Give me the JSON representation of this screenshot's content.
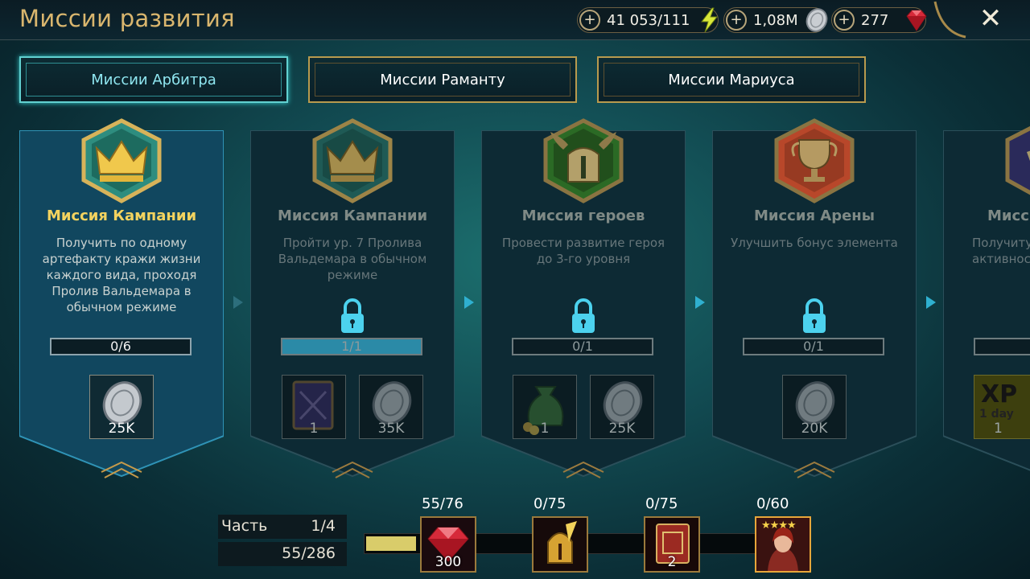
{
  "header": {
    "title": "Миссии развития",
    "resources": [
      {
        "name": "energy",
        "value": "41 053/111",
        "icon": "lightning-icon"
      },
      {
        "name": "silver",
        "value": "1,08M",
        "icon": "silver-coin-icon"
      },
      {
        "name": "gems",
        "value": "277",
        "icon": "ruby-icon"
      }
    ],
    "close_icon": "close-icon"
  },
  "tabs": [
    {
      "label": "Миссии Арбитра",
      "active": true
    },
    {
      "label": "Миссии Раманту",
      "active": false
    },
    {
      "label": "Миссии Мариуса",
      "active": false
    }
  ],
  "missions": [
    {
      "title": "Миссия Кампании",
      "description": "Получить по одному артефакту кражи жизни каждого вида, проходя Пролив Вальдемара в обычном режиме",
      "progress": "0/6",
      "progress_fraction": 0,
      "locked": false,
      "emblem": "crown-emblem-icon",
      "rewards": [
        {
          "icon": "silver-coin-icon",
          "qty": "25K"
        }
      ]
    },
    {
      "title": "Миссия Кампании",
      "description": "Пройти ур. 7 Пролива Вальдемара в обычном режиме",
      "progress": "1/1",
      "progress_fraction": 1,
      "locked": true,
      "emblem": "crown-emblem-icon",
      "rewards": [
        {
          "icon": "tome-icon",
          "qty": "1"
        },
        {
          "icon": "silver-coin-icon",
          "qty": "35K"
        }
      ]
    },
    {
      "title": "Миссия героев",
      "description": "Провести развитие героя до 3-го уровня",
      "progress": "0/1",
      "progress_fraction": 0,
      "locked": true,
      "emblem": "helmet-emblem-icon",
      "rewards": [
        {
          "icon": "money-bag-icon",
          "qty": "1"
        },
        {
          "icon": "silver-coin-icon",
          "qty": "25K"
        }
      ]
    },
    {
      "title": "Миссия Арены",
      "description": "Улучшить бонус элемента",
      "progress": "0/1",
      "progress_fraction": 0,
      "locked": true,
      "emblem": "trophy-emblem-icon",
      "rewards": [
        {
          "icon": "silver-coin-icon",
          "qty": "20K"
        }
      ]
    },
    {
      "title": "Мисс",
      "description": "Получиту активнос",
      "progress": "",
      "progress_fraction": 0,
      "locked": false,
      "emblem": "scroll-emblem-icon",
      "rewards": [
        {
          "icon": "xp-boost-icon",
          "label": "XP",
          "sublabel": "1 day",
          "qty": "1"
        }
      ]
    }
  ],
  "part": {
    "label": "Часть",
    "value": "1/4",
    "points": "55/286",
    "fill_fraction": 0.12
  },
  "milestones": [
    {
      "label": "55/76",
      "icon": "ruby-icon",
      "qty": "300"
    },
    {
      "label": "0/75",
      "icon": "golden-helmet-icon",
      "qty": ""
    },
    {
      "label": "0/75",
      "icon": "red-tome-icon",
      "qty": "2"
    },
    {
      "label": "0/60",
      "icon": "champion-portrait-icon",
      "qty": "",
      "stars": 4
    }
  ]
}
